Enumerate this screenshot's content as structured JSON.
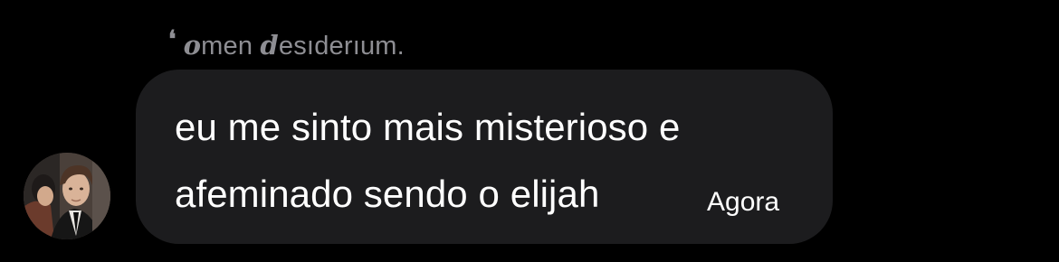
{
  "sender": {
    "mark": "❛",
    "name_parts": [
      {
        "text": "o",
        "style": "fancy"
      },
      {
        "text": "men ",
        "style": "plain"
      },
      {
        "text": "d",
        "style": "fancy"
      },
      {
        "text": "esıderıum.",
        "style": "plain"
      }
    ]
  },
  "message": {
    "lines": [
      "eu me sinto mais misterioso e",
      "afeminado sendo o elijah"
    ],
    "time": "Agora"
  },
  "colors": {
    "background": "#000000",
    "bubble": "#1c1c1e",
    "message_text": "#ffffff",
    "sender_text": "#8e8e93"
  },
  "avatar": {
    "icon": "profile-photo"
  }
}
